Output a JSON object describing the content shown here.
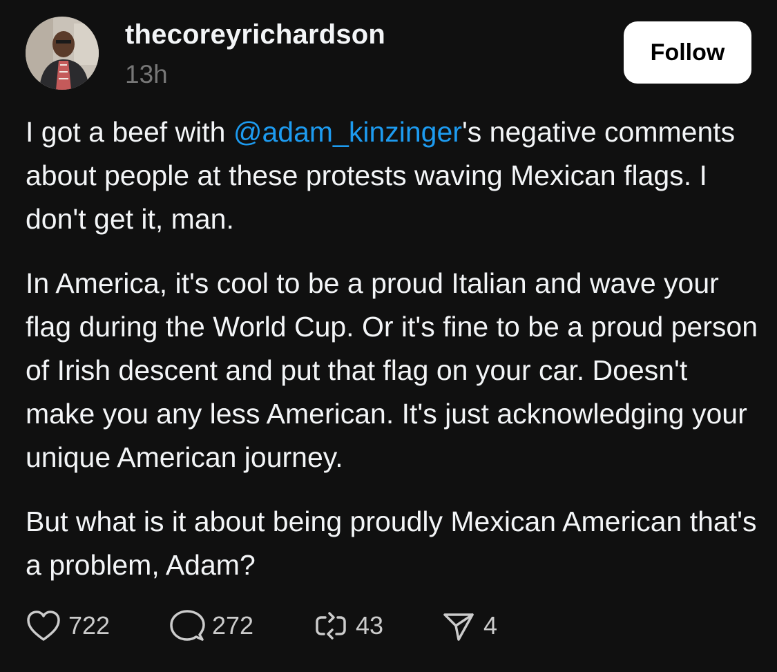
{
  "post": {
    "username": "thecoreyrichardson",
    "timestamp": "13h",
    "follow_label": "Follow",
    "body": {
      "p1_before": "I got a beef with ",
      "p1_mention": "@adam_kinzinger",
      "p1_after": "'s negative comments about people at these protests waving Mexican flags. I don't get it, man.",
      "p2": "In America, it's cool to be a proud Italian and wave your flag during the World Cup. Or it's fine to be a proud person of Irish descent and put that flag on your car. Doesn't make you any less American. It's just acknowledging your unique American journey.",
      "p3": "But what is it about being proudly Mexican American that's a problem, Adam?"
    },
    "actions": {
      "likes": "722",
      "replies": "272",
      "reposts": "43",
      "shares": "4"
    }
  },
  "colors": {
    "background": "#101010",
    "text": "#f3f5f7",
    "secondary": "#777777",
    "mention": "#1d9bf0",
    "follow_bg": "#ffffff"
  },
  "icons": [
    "heart-icon",
    "comment-icon",
    "repost-icon",
    "share-icon"
  ]
}
